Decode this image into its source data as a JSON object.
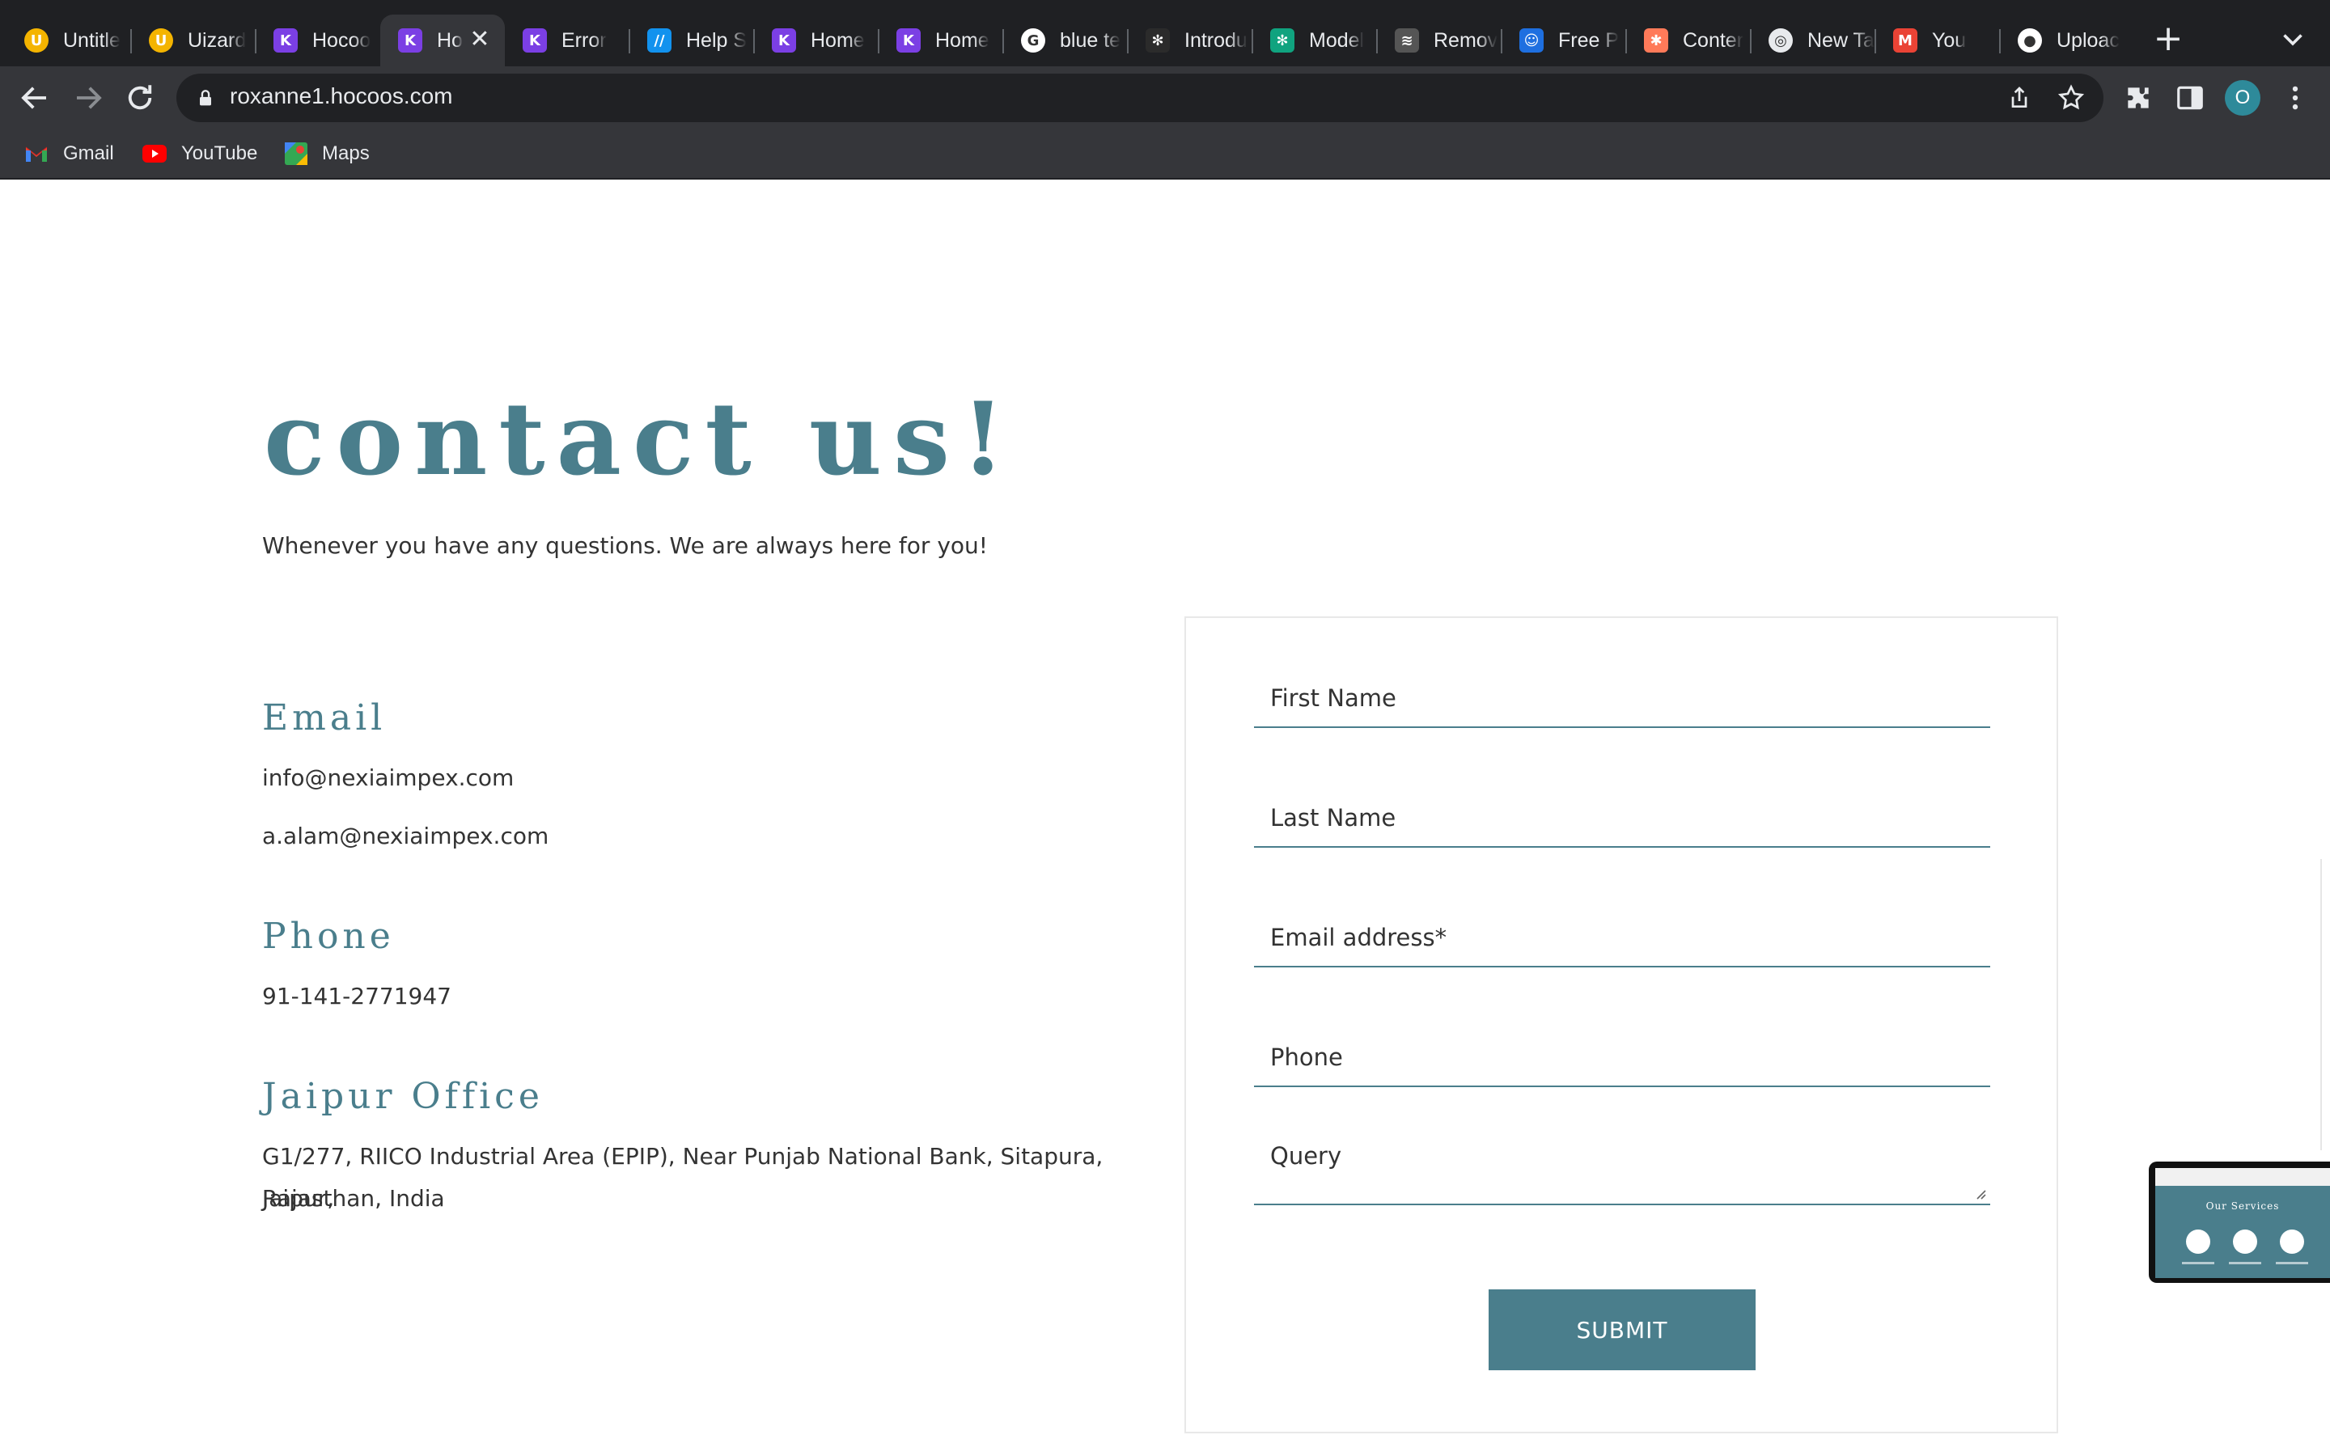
{
  "browser": {
    "tabs": [
      {
        "title": "Untitle",
        "icon": "uizard-icon",
        "color": "#f4b400",
        "glyph": "U"
      },
      {
        "title": "Uizard",
        "icon": "uizard-icon",
        "color": "#f4b400",
        "glyph": "U"
      },
      {
        "title": "Hocoo",
        "icon": "hocoos-icon",
        "color": "#7b3fe4",
        "glyph": "K"
      },
      {
        "title": "Ho",
        "icon": "hocoos-icon",
        "color": "#7b3fe4",
        "glyph": "K",
        "active": true
      },
      {
        "title": "Error",
        "icon": "hocoos-icon",
        "color": "#7b3fe4",
        "glyph": "K"
      },
      {
        "title": "Help S",
        "icon": "help-scout-icon",
        "color": "#1292ee",
        "glyph": "//"
      },
      {
        "title": "Home",
        "icon": "hocoos-icon",
        "color": "#7b3fe4",
        "glyph": "K"
      },
      {
        "title": "Home",
        "icon": "hocoos-icon",
        "color": "#7b3fe4",
        "glyph": "K"
      },
      {
        "title": "blue te",
        "icon": "google-icon",
        "color": "#ffffff",
        "glyph": "G"
      },
      {
        "title": "Introdu",
        "icon": "openai-icon",
        "color": "#2b2b2b",
        "glyph": "✻"
      },
      {
        "title": "Model",
        "icon": "chatgpt-icon",
        "color": "#10a37f",
        "glyph": "✻"
      },
      {
        "title": "Remov",
        "icon": "layers-icon",
        "color": "#555555",
        "glyph": "≋"
      },
      {
        "title": "Free P",
        "icon": "freepik-icon",
        "color": "#1e6fe0",
        "glyph": "☺"
      },
      {
        "title": "Conter",
        "icon": "hubspot-icon",
        "color": "#ff7a59",
        "glyph": "✱"
      },
      {
        "title": "New Ta",
        "icon": "chrome-icon",
        "color": "#e8eaed",
        "glyph": "◎"
      },
      {
        "title": "You",
        "icon": "gmail-icon",
        "color": "#ea4335",
        "glyph": "M"
      },
      {
        "title": "Uploac",
        "icon": "github-icon",
        "color": "#ffffff",
        "glyph": "●"
      }
    ],
    "new_tab_label": "+",
    "close_tab_glyph": "✕",
    "url": "roxanne1.hocoos.com",
    "profile_initial": "O",
    "bookmarks": [
      {
        "label": "Gmail",
        "icon": "gmail-icon"
      },
      {
        "label": "YouTube",
        "icon": "youtube-icon"
      },
      {
        "label": "Maps",
        "icon": "maps-icon"
      }
    ],
    "colors": {
      "frame": "#1f2023",
      "toolbar": "#35363a",
      "omnibox": "#202124"
    }
  },
  "page": {
    "heading": "contact us!",
    "subtitle": "Whenever you have any questions. We are always here for you!",
    "email": {
      "title": "Email",
      "lines": [
        "info@nexiaimpex.com",
        "a.alam@nexiaimpex.com"
      ]
    },
    "phone": {
      "title": "Phone",
      "value": "91-141-2771947"
    },
    "office": {
      "title": "Jaipur Office",
      "address_line1": "G1/277, RIICO Industrial Area (EPIP), Near Punjab National Bank, Sitapura, Jaipur,",
      "address_line2": "Rajasthan, India"
    },
    "form": {
      "first_name_placeholder": "First Name",
      "last_name_placeholder": "Last Name",
      "email_placeholder": "Email address*",
      "phone_placeholder": "Phone",
      "query_placeholder": "Query",
      "submit_label": "SUBMIT"
    },
    "thumbnail": {
      "title": "Our Services"
    },
    "colors": {
      "accent": "#4a7e8c",
      "text": "#333333"
    }
  }
}
